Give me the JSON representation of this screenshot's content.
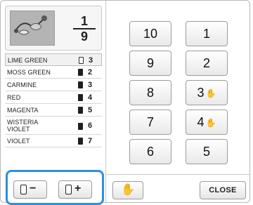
{
  "preview": {
    "thumbnail": "embroidery-pattern-thumbnail",
    "current": "1",
    "total": "9"
  },
  "threads": [
    {
      "name": "LIME GREEN",
      "count": "3",
      "spool": "light"
    },
    {
      "name": "MOSS GREEN",
      "count": "2",
      "spool": "dark"
    },
    {
      "name": "CARMINE",
      "count": "3",
      "spool": "dark"
    },
    {
      "name": "RED",
      "count": "4",
      "spool": "dark"
    },
    {
      "name": "MAGENTA",
      "count": "5",
      "spool": "dark"
    },
    {
      "name": "WISTERIA\nVIOLET",
      "count": "6",
      "spool": "dark"
    },
    {
      "name": "VIOLET",
      "count": "7",
      "spool": "dark"
    }
  ],
  "controls": {
    "minus_label": "−",
    "plus_label": "+"
  },
  "spool_buttons": {
    "s10": "10",
    "s9": "9",
    "s8": "8",
    "s7": "7",
    "s6": "6",
    "s1": "1",
    "s2": "2",
    "s3": "3",
    "s4": "4",
    "s5": "5"
  },
  "footer": {
    "close_label": "CLOSE",
    "hand_icon": "hand-icon"
  }
}
